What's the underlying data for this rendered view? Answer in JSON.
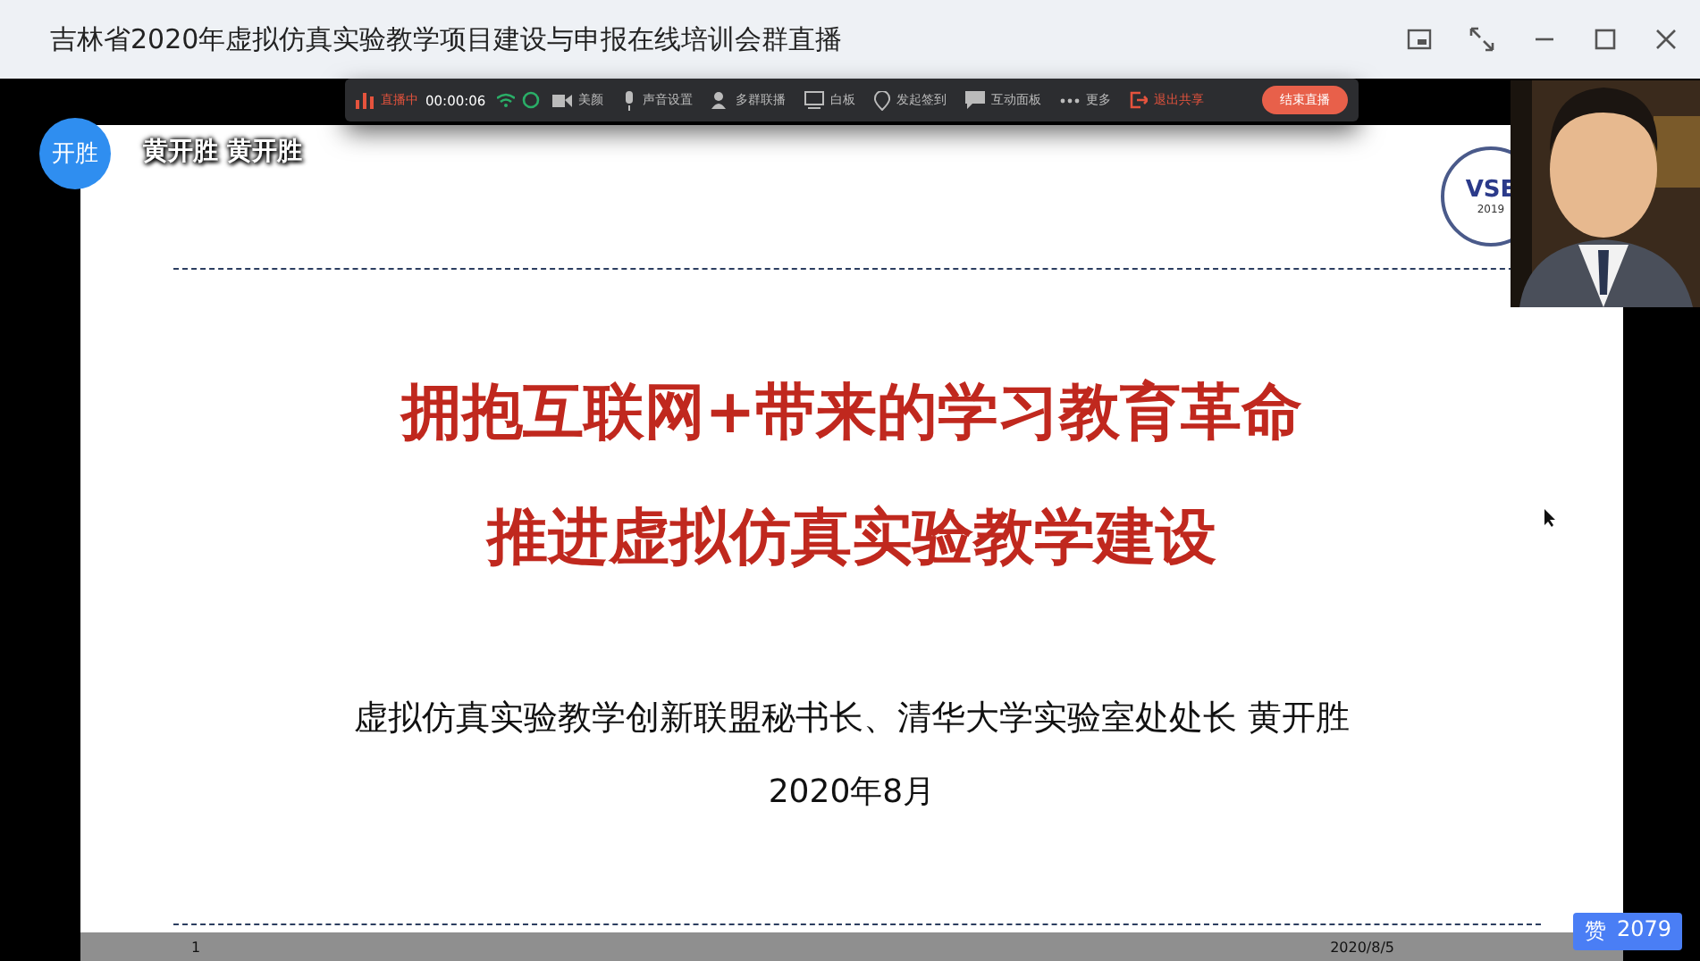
{
  "window": {
    "title": "吉林省2020年虚拟仿真实验教学项目建设与申报在线培训会群直播"
  },
  "toolbar": {
    "live_status": "直播中",
    "timer": "00:00:06",
    "items": [
      {
        "kind": "camera",
        "label": "美颜"
      },
      {
        "kind": "mic",
        "label": "声音设置"
      },
      {
        "kind": "people",
        "label": "多群联播"
      },
      {
        "kind": "board",
        "label": "白板"
      },
      {
        "kind": "pin",
        "label": "发起签到"
      },
      {
        "kind": "chat",
        "label": "互动面板"
      },
      {
        "kind": "more",
        "label": "更多"
      }
    ],
    "exit_share": "退出共享",
    "end_button": "结束直播"
  },
  "presenter": {
    "avatar_text": "开胜",
    "name_overlay": "黄开胜 黄开胜"
  },
  "slide": {
    "logo": {
      "text": "VSE",
      "year": "2019"
    },
    "title_lines": [
      "拥抱互联网+带来的学习教育革命",
      "推进虚拟仿真实验教学建设"
    ],
    "subtitle": "虚拟仿真实验教学创新联盟秘书长、清华大学实验室处处长 黄开胜",
    "date": "2020年8月",
    "footer": {
      "page": "1",
      "date": "2020/8/5"
    }
  },
  "likes": {
    "label": "赞",
    "count": "2079"
  }
}
